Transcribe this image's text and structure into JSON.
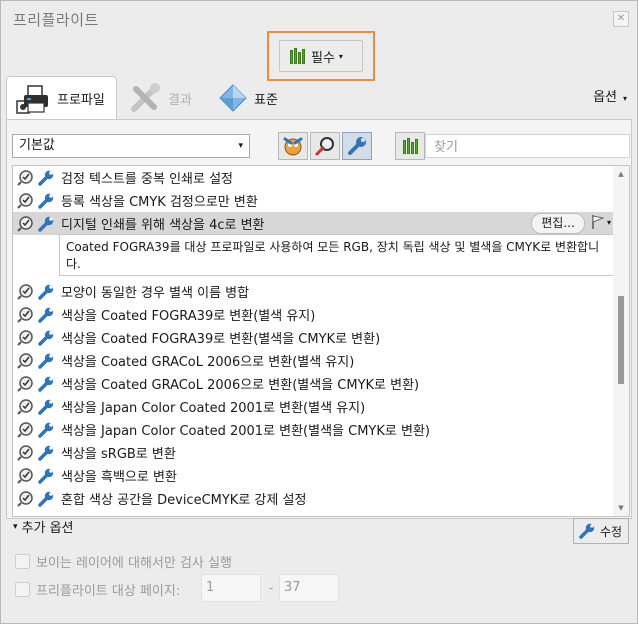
{
  "window": {
    "title": "프리플라이트",
    "close_label": "✕"
  },
  "essential": {
    "label": "필수",
    "arrow": "▾"
  },
  "tabs": [
    {
      "label": "프로파일",
      "icon": "printer-icon",
      "active": true
    },
    {
      "label": "결과",
      "icon": "wrench-cross-icon",
      "active": false
    },
    {
      "label": "표준",
      "icon": "diamond-icon",
      "active": false
    }
  ],
  "options": {
    "label": "옵션",
    "arrow": "▾"
  },
  "toolbar": {
    "profile_select_value": "기본값",
    "profile_select_arrow": "▾",
    "search_placeholder": "찾기"
  },
  "list": {
    "items": [
      "검정 텍스트를 중복 인쇄로 설정",
      "등록 색상을 CMYK 검정으로만 변환",
      "디지털 인쇄를 위해 색상을 4c로 변환",
      "모양이 동일한 경우 별색 이름 병합",
      "색상을 Coated FOGRA39로 변환(별색 유지)",
      "색상을 Coated FOGRA39로 변환(별색을 CMYK로 변환)",
      "색상을 Coated GRACoL 2006으로 변환(별색 유지)",
      "색상을 Coated GRACoL 2006으로 변환(별색을 CMYK로 변환)",
      "색상을 Japan Color Coated 2001로 변환(별색 유지)",
      "색상을 Japan Color Coated 2001로 변환(별색을 CMYK로 변환)",
      "색상을 sRGB로 변환",
      "색상을 흑백으로 변환",
      "혼합 색상 공간을 DeviceCMYK로 강제 설정"
    ],
    "selected_edit_label": "편집...",
    "selected_description": "Coated FOGRA39를 대상 프로파일로 사용하여 모든 RGB, 장치 독립 색상 및 별색을 CMYK로 변환합니다."
  },
  "bottom": {
    "more_options_label": "추가 옵션",
    "more_options_triangle": "▾",
    "fix_label": "수정",
    "visible_layers_label": "보이는 레이어에 대해서만 검사 실행",
    "pages_label": "프리플라이트 대상 페이지:",
    "page_from": "1",
    "page_to": "37",
    "page_dash": "-"
  },
  "colors": {
    "accent_highlight": "#f08a3c",
    "green_bars": "#58a52a",
    "wrench_blue": "#2f74b8"
  }
}
